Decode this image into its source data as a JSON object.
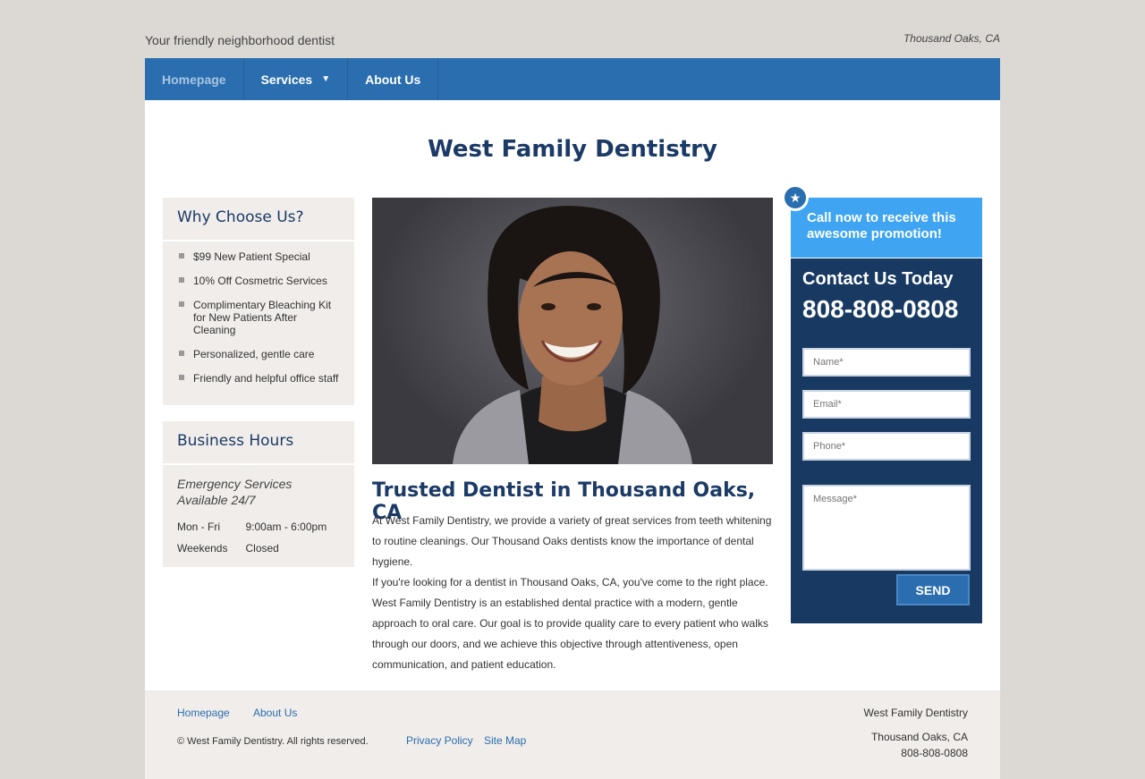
{
  "header": {
    "tagline": "Your friendly neighborhood dentist",
    "location": "Thousand Oaks, CA"
  },
  "nav": {
    "items": [
      {
        "label": "Homepage"
      },
      {
        "label": "Services"
      },
      {
        "label": "About Us"
      }
    ]
  },
  "main": {
    "site_title": "West Family Dentistry",
    "why": {
      "heading": "Why Choose Us?",
      "items": [
        "$99 New Patient Special",
        "10% Off Cosmetric Services",
        "Complimentary Bleaching Kit for New Patients After Cleaning",
        "Personalized, gentle care",
        "Friendly and helpful office staff"
      ]
    },
    "hours": {
      "heading": "Business Hours",
      "emergency": "Emergency Services Available 24/7",
      "rows": [
        {
          "days": "Mon - Fri",
          "time": "9:00am - 6:00pm"
        },
        {
          "days": "Weekends",
          "time": "Closed"
        }
      ]
    },
    "article": {
      "title": "Trusted Dentist in Thousand Oaks, CA",
      "paragraphs": [
        "At West Family Dentistry, we provide a variety of great services from teeth whitening to routine cleanings. Our Thousand Oaks dentists know the importance of dental hygiene.",
        "If you're looking for a dentist in Thousand Oaks, CA, you've come to the right place. West Family Dentistry is an established dental practice with a modern, gentle approach to oral care. Our goal is to provide quality care to every patient who walks through our doors, and we achieve this objective through attentiveness, open communication, and patient education."
      ]
    },
    "promo": {
      "text": "Call now to receive this awesome promotion!",
      "icon": "star-icon"
    },
    "contact": {
      "heading": "Contact Us Today",
      "phone": "808-808-0808",
      "name_placeholder": "Name*",
      "email_placeholder": "Email*",
      "phone_placeholder": "Phone*",
      "message_placeholder": "Message*",
      "send_label": "SEND"
    }
  },
  "footer": {
    "links_top": [
      "Homepage",
      "About Us"
    ],
    "copyright": "© West Family Dentistry. All rights reserved.",
    "links_bottom": [
      "Privacy Policy",
      "Site Map"
    ],
    "business_name": "West Family Dentistry",
    "city": "Thousand Oaks, CA",
    "phone": "808-808-0808"
  },
  "colors": {
    "nav_blue": "#2b6eaf",
    "heading_navy": "#1b3a66",
    "promo_blue": "#3fa5f2",
    "contact_navy": "#173962",
    "page_bg": "#dcd9d5"
  }
}
